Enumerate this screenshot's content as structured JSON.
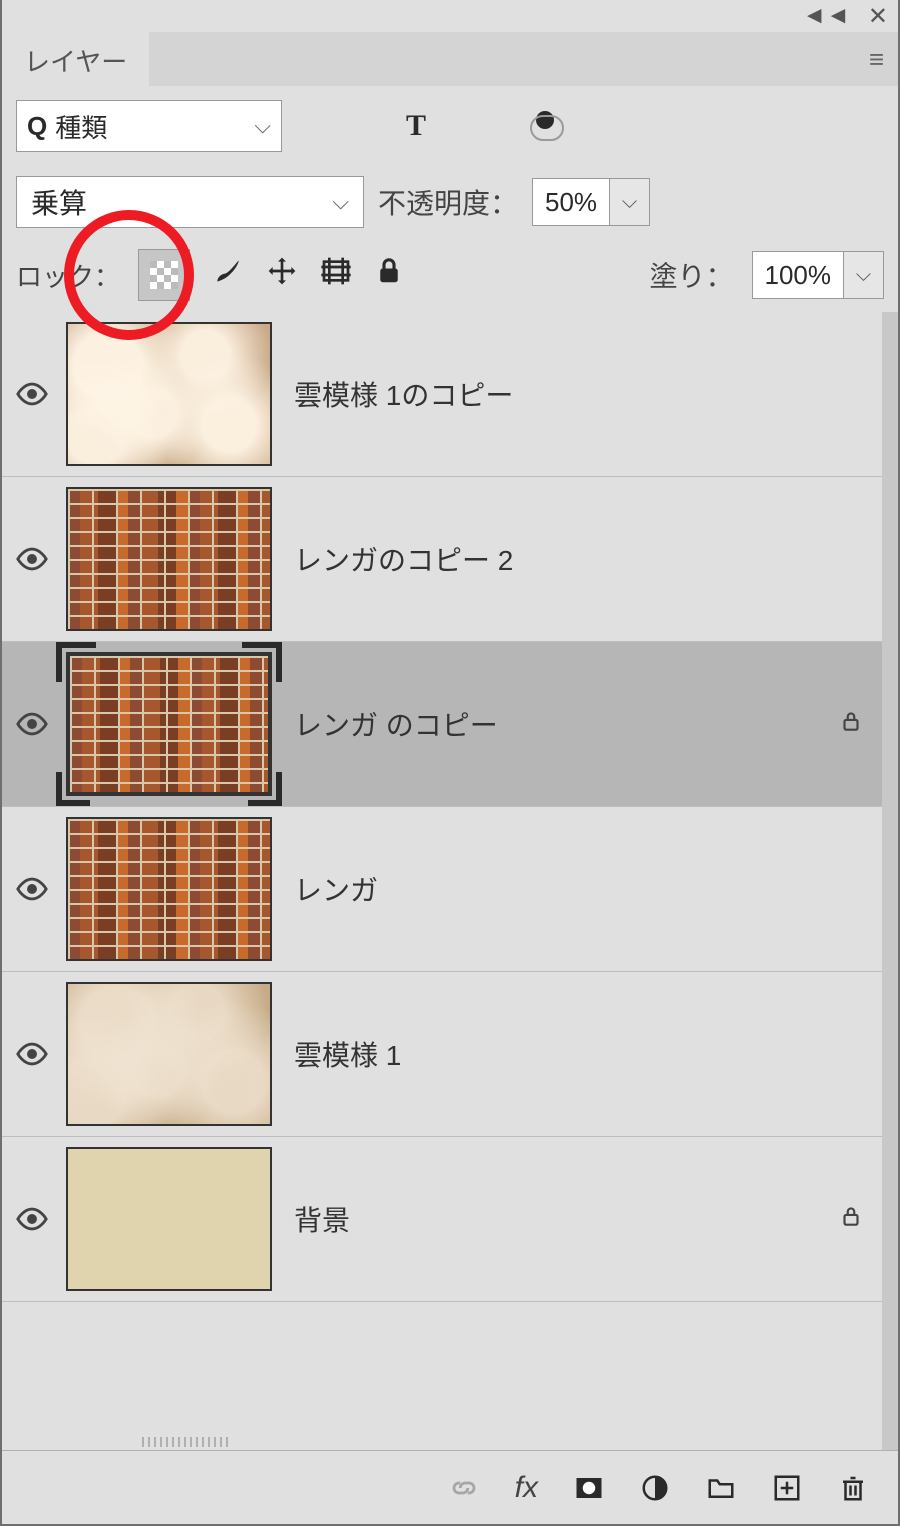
{
  "panel": {
    "tab": "レイヤー",
    "search_prefix": "Q",
    "search_label": "種類",
    "blend_mode": "乗算",
    "opacity_label": "不透明度：",
    "opacity_value": "50%",
    "lock_label": "ロック：",
    "fill_label": "塗り：",
    "fill_value": "100%"
  },
  "filter_icons": {
    "image": "image-icon",
    "adjust": "half-circle-icon",
    "type": "T",
    "shape": "shape-icon",
    "smart": "smart-object-icon"
  },
  "layers": [
    {
      "name": "雲模様 1のコピー",
      "texture": "t-clouds",
      "selected": false,
      "locked": false
    },
    {
      "name": "レンガのコピー 2",
      "texture": "t-brick",
      "selected": false,
      "locked": false
    },
    {
      "name": "レンガ のコピー",
      "texture": "t-brick",
      "selected": true,
      "locked": true
    },
    {
      "name": "レンガ",
      "texture": "t-brick",
      "selected": false,
      "locked": false
    },
    {
      "name": "雲模様 1",
      "texture": "t-clouds2",
      "selected": false,
      "locked": false
    },
    {
      "name": "背景",
      "texture": "t-bg",
      "selected": false,
      "locked": true
    }
  ],
  "bottom": {
    "link": "link-icon",
    "fx": "fx",
    "mask": "mask-icon",
    "adjust": "adjust-icon",
    "group": "folder-icon",
    "new": "new-layer-icon",
    "trash": "trash-icon"
  }
}
